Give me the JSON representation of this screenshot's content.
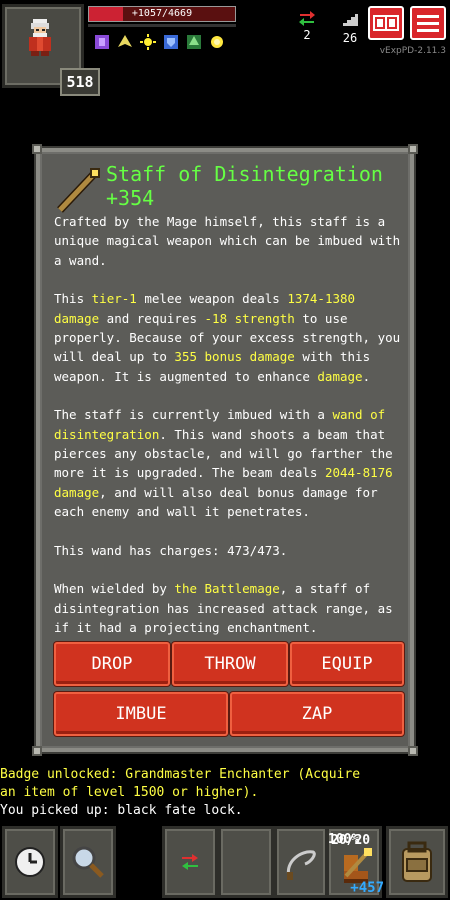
{
  "hud": {
    "hero_level": "518",
    "hp_text": "+1057/4669",
    "hp_fraction": 0.23,
    "loot_count": "2",
    "depth": "26",
    "version": "vExpPD-2.11.3",
    "buff_icons": [
      "purple-shield-buff",
      "yellow-wing-buff",
      "sun-buff",
      "blue-armor-buff",
      "green-tree-buff",
      "light-buff"
    ]
  },
  "item": {
    "icon": "staff-icon",
    "title_line1": "Staff of Disintegration",
    "title_line2": "+354",
    "p1": "Crafted by the Mage himself, this staff is a unique magical weapon which can be imbued with a wand.",
    "p2_a": "This ",
    "p2_tier": "tier-1",
    "p2_b": " melee weapon deals ",
    "p2_damage": "1374-1380 damage",
    "p2_c": " and requires ",
    "p2_str": "-18 strength",
    "p2_d": " to use properly. Because of your excess strength, you will deal up to ",
    "p2_bonus": "355 bonus damage",
    "p2_e": " with this weapon. It is augmented to enhance ",
    "p2_aug": "damage",
    "p2_f": ".",
    "p3_a": "The staff is currently imbued with a ",
    "p3_wand": "wand of disintegration",
    "p3_b": ". This wand shoots a beam that pierces any obstacle, and will go farther the more it is upgraded. The beam deals ",
    "p3_dmg": "2044-8176 damage",
    "p3_c": ", and will also deal bonus damage for each enemy and wall it penetrates.",
    "p4": "This wand has charges: 473/473.",
    "p5_a": "When wielded by ",
    "p5_class": "the Battlemage",
    "p5_b": ", a staff of disintegration has increased attack range, as if it had a projecting enchantment."
  },
  "actions": {
    "drop": "DROP",
    "throw": "THROW",
    "equip": "EQUIP",
    "imbue": "IMBUE",
    "zap": "ZAP"
  },
  "log": {
    "badge_line1": "Badge unlocked: Grandmaster Enchanter (Acquire",
    "badge_line2": "an item of level 1500 or higher).",
    "pickup": "You picked up: black fate lock."
  },
  "toolbar": {
    "quick3_qty": "20/20",
    "quick4_qty": "100%",
    "quick4_bonus": "+457"
  },
  "colors": {
    "highlight": "#ffff44",
    "title": "#66ff44",
    "button": "#d0331f",
    "window": "#5c5c58"
  }
}
